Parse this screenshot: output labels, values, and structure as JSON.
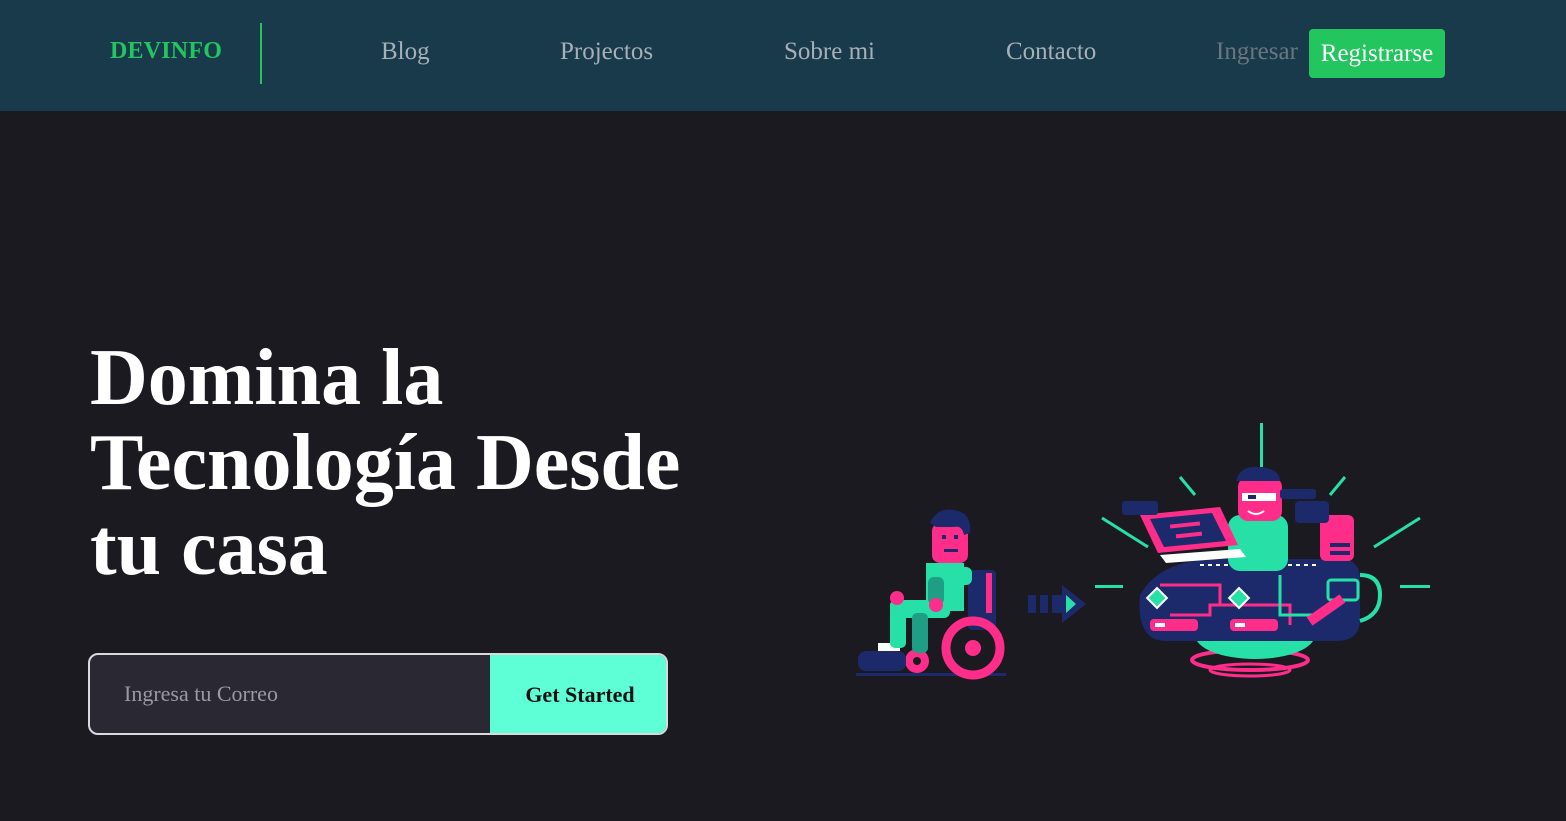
{
  "nav": {
    "brand": "DEVINFO",
    "links": [
      {
        "label": "Blog"
      },
      {
        "label": "Projectos"
      },
      {
        "label": "Sobre mi"
      },
      {
        "label": "Contacto"
      }
    ],
    "login_label": "Ingresar",
    "register_label": "Registrarse"
  },
  "hero": {
    "title_line1": "Domina la",
    "title_line2": "Tecnología Desde",
    "title_line3": "tu casa",
    "email_placeholder": "Ingresa tu Correo",
    "cta_label": "Get Started"
  },
  "colors": {
    "nav_bg": "#183a4a",
    "page_bg": "#1b1a20",
    "brand": "#22c55e",
    "cta": "#5effd6",
    "illustration_teal": "#27e0a8",
    "illustration_pink": "#ff2d8a",
    "illustration_navy": "#1c2a6b"
  },
  "illustration": {
    "description_icon": "accessibility-tech-illustration"
  }
}
